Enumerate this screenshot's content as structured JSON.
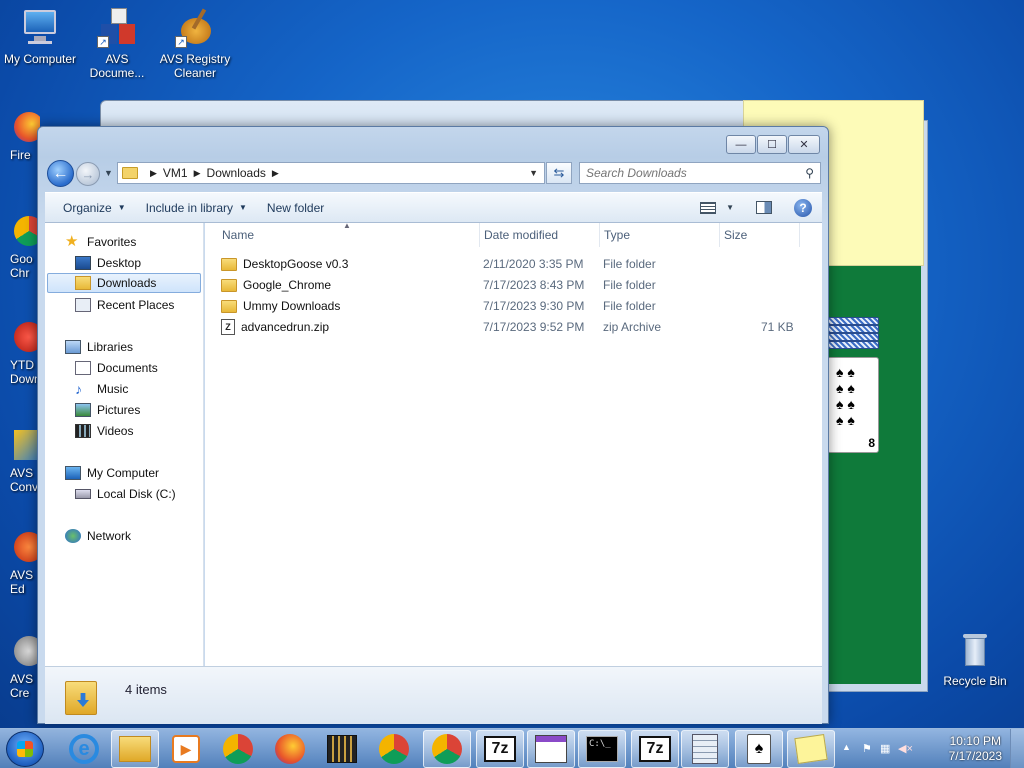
{
  "desktop": {
    "icons": [
      {
        "label": "My Computer"
      },
      {
        "label": "AVS Docume..."
      },
      {
        "label": "AVS Registry Cleaner"
      },
      {
        "label": "Recycle Bin"
      }
    ],
    "left_partial": [
      "Fire",
      "Goo Chr",
      "YTD Down",
      "AVS Conv",
      "AVS Ed",
      "AVS Cre"
    ]
  },
  "explorer": {
    "title_buttons": {
      "minimize": "—",
      "maximize": "☐",
      "close": "✕"
    },
    "breadcrumb": [
      "VM1",
      "Downloads"
    ],
    "search_placeholder": "Search Downloads",
    "toolbar": {
      "organize": "Organize",
      "include_in_library": "Include in library",
      "new_folder": "New folder"
    },
    "nav": {
      "favorites": "Favorites",
      "desktop": "Desktop",
      "downloads": "Downloads",
      "recent_places": "Recent Places",
      "libraries": "Libraries",
      "documents": "Documents",
      "music": "Music",
      "pictures": "Pictures",
      "videos": "Videos",
      "my_computer": "My Computer",
      "local_disk": "Local Disk (C:)",
      "network": "Network"
    },
    "columns": {
      "name": "Name",
      "date": "Date modified",
      "type": "Type",
      "size": "Size"
    },
    "files": [
      {
        "name": "DesktopGoose v0.3",
        "date": "2/11/2020 3:35 PM",
        "type": "File folder",
        "size": "",
        "kind": "folder"
      },
      {
        "name": "Google_Chrome",
        "date": "7/17/2023 8:43 PM",
        "type": "File folder",
        "size": "",
        "kind": "folder"
      },
      {
        "name": "Ummy Downloads",
        "date": "7/17/2023 9:30 PM",
        "type": "File folder",
        "size": "",
        "kind": "folder"
      },
      {
        "name": "advancedrun.zip",
        "date": "7/17/2023 9:52 PM",
        "type": "zip Archive",
        "size": "71 KB",
        "kind": "zip"
      }
    ],
    "status": "4 items"
  },
  "taskbar": {
    "apps": [
      "Internet Explorer",
      "Windows Explorer",
      "Media Player",
      "Google Chrome",
      "Firefox",
      "Video Editor",
      "Google Chrome",
      "Google Chrome",
      "7-Zip",
      "Control Panel",
      "Command Prompt",
      "7-Zip",
      "Calculator",
      "Solitaire",
      "Sticky Notes"
    ],
    "time": "10:10 PM",
    "date": "7/17/2023"
  },
  "colors": {
    "selected": "#cfe4fb",
    "folder": "#e8b838",
    "desktop": "#1565c8"
  }
}
